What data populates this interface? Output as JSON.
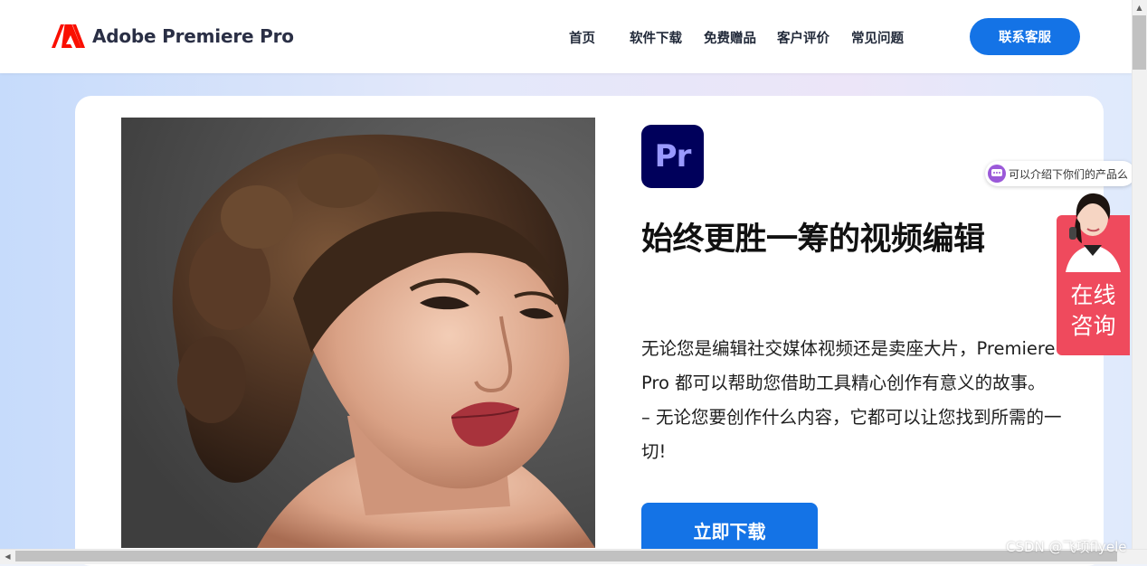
{
  "header": {
    "brand": "Adobe Premiere Pro",
    "nav": [
      "首页",
      "软件下载",
      "免费赠品",
      "客户评价",
      "常见问题"
    ],
    "contact_label": "联系客服"
  },
  "hero": {
    "badge_text": "Pr",
    "headline": "始终更胜一筹的视频编辑",
    "description_lines": [
      "无论您是编辑社交媒体视频还是卖座大片，Premiere Pro 都可以帮助您借助工具精心创作有意义的故事。",
      "– 无论您要创作什么内容，它都可以让您找到所需的一切!"
    ],
    "download_label": "立即下载"
  },
  "chat": {
    "bubble_text": "可以介绍下你们的产品么",
    "consult_label": "在线咨询"
  },
  "watermark": "CSDN @飞项flyele",
  "colors": {
    "accent": "#1473e6",
    "pr_badge_bg": "#00005b",
    "pr_badge_text": "#9999ff",
    "consult_bg": "#ef4a5d",
    "adobe_red": "#fa0f00"
  }
}
